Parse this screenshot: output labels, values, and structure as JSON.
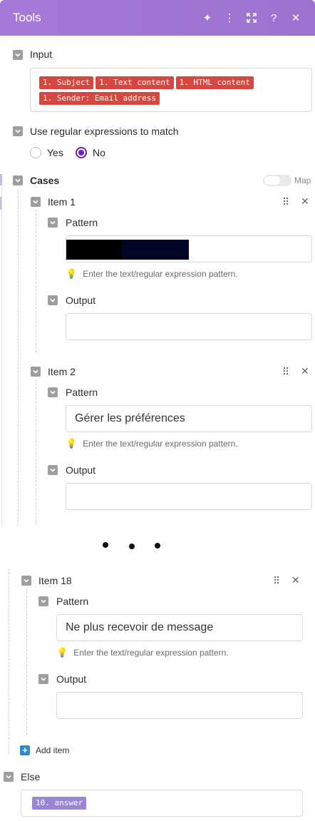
{
  "header": {
    "title": "Tools",
    "icons": [
      "sparkle-icon",
      "more-vertical-icon",
      "expand-icon",
      "help-icon",
      "close-icon"
    ]
  },
  "input": {
    "label": "Input",
    "tags": [
      "1. Subject",
      "1. Text content",
      "1. HTML content",
      "1. Sender: Email address"
    ]
  },
  "regex": {
    "label": "Use regular expressions to match",
    "options": [
      "Yes",
      "No"
    ],
    "selected": "No"
  },
  "cases": {
    "label": "Cases",
    "map_label": "Map",
    "pattern_label": "Pattern",
    "output_label": "Output",
    "hint": "Enter the text/regular expression pattern.",
    "items": [
      {
        "label": "Item 1",
        "pattern": "",
        "output": ""
      },
      {
        "label": "Item 2",
        "pattern": "Gérer les préférences",
        "output": ""
      },
      {
        "label": "Item 18",
        "pattern": "Ne plus recevoir de message",
        "output": ""
      }
    ],
    "add_item": "Add item"
  },
  "else": {
    "label": "Else",
    "tag": "10. answer"
  },
  "colors": {
    "header": "#a57ad6",
    "tag": "#d7463f",
    "else_tag": "#9b86d6",
    "radio_selected": "#6b1fc7",
    "add_icon": "#2d8bc9"
  }
}
